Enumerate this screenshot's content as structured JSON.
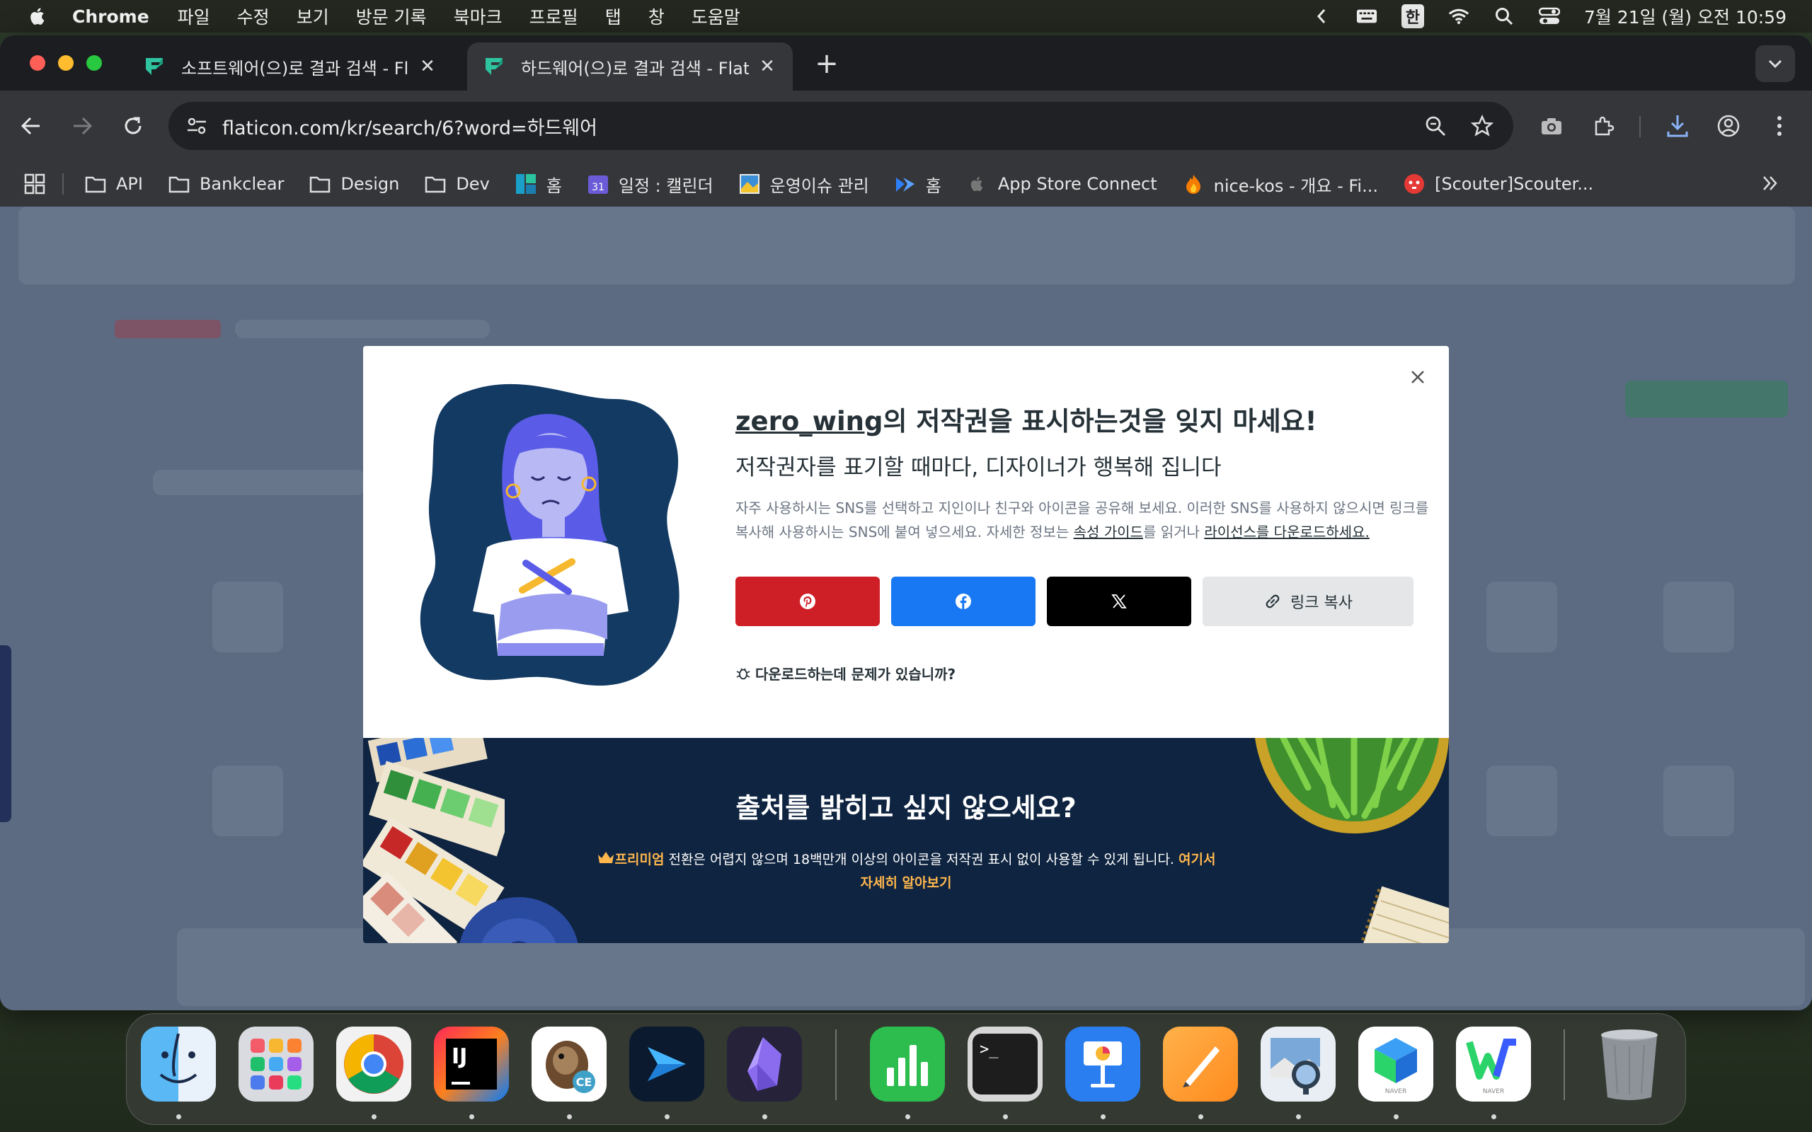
{
  "menubar": {
    "app_name": "Chrome",
    "items": [
      "파일",
      "수정",
      "보기",
      "방문 기록",
      "북마크",
      "프로필",
      "탭",
      "창",
      "도움말"
    ],
    "ime": "한",
    "clock": "7월 21일 (월) 오전 10:59"
  },
  "tabs": [
    {
      "title": "소프트웨어(으)로 결과 검색 - Flaticon",
      "active": false
    },
    {
      "title": "하드웨어(으)로 결과 검색 - Flaticon",
      "active": true
    }
  ],
  "omnibox": {
    "url": "flaticon.com/kr/search/6?word=하드웨어"
  },
  "bookmarks": [
    {
      "label": "API",
      "icon": "folder-icon"
    },
    {
      "label": "Bankclear",
      "icon": "folder-icon"
    },
    {
      "label": "Design",
      "icon": "folder-icon"
    },
    {
      "label": "Dev",
      "icon": "folder-icon"
    },
    {
      "label": "홈",
      "icon": "board-icon"
    },
    {
      "label": "일정 : 캘린더",
      "icon": "calendar-icon"
    },
    {
      "label": "운영이슈 관리",
      "icon": "image-icon"
    },
    {
      "label": "홈",
      "icon": "flow-icon"
    },
    {
      "label": "App Store Connect",
      "icon": "apple-icon"
    },
    {
      "label": "nice-kos - 개요 - Fi...",
      "icon": "flame-icon"
    },
    {
      "label": "[Scouter]Scouter...",
      "icon": "scouter-icon"
    }
  ],
  "modal": {
    "author": "zero_wing",
    "heading_suffix": "의 저작권을 표시하는것을 잊지 마세요!",
    "subheading": "저작권자를 표기할 때마다, 디자이너가 행복해 집니다",
    "desc_part1": "자주 사용하시는 SNS를 선택하고 지인이나 친구와 아이콘을 공유해 보세요. 이러한 SNS를 사용하지 않으시면 링크를 복사해 사용하시는 SNS에 붙여 넣으세요. 자세한 정보는 ",
    "desc_link1": "속성 가이드",
    "desc_part2": "를 읽거나 ",
    "desc_link2": "라이선스를 다운로드하세요.",
    "copy_link_label": "링크 복사",
    "trouble_text": "다운로드하는데 문제가 있습니까?",
    "banner_title": "출처를 밝히고 싶지 않으세요?",
    "banner_premium": "프리미엄",
    "banner_text": " 전환은 어렵지 않으며 18백만개 이상의 아이콘을 저작권 표시 없이 사용할 수 있게 됩니다. ",
    "banner_more": "여기서 자세히 알아보기"
  },
  "colors": {
    "pinterest": "#cf1f26",
    "facebook": "#1877f2",
    "x": "#000000",
    "premium": "#ffb74d",
    "banner_bg": "#0f2440"
  },
  "dock": [
    "finder-icon",
    "launchpad-icon",
    "chrome-icon",
    "intellij-icon",
    "dbeaver-icon",
    "azure-data-studio-icon",
    "obsidian-icon",
    "numbers-icon",
    "terminal-icon",
    "keynote-icon",
    "pages-icon",
    "preview-icon",
    "naver-works-icon",
    "naver-whale-icon",
    "trash-icon"
  ]
}
